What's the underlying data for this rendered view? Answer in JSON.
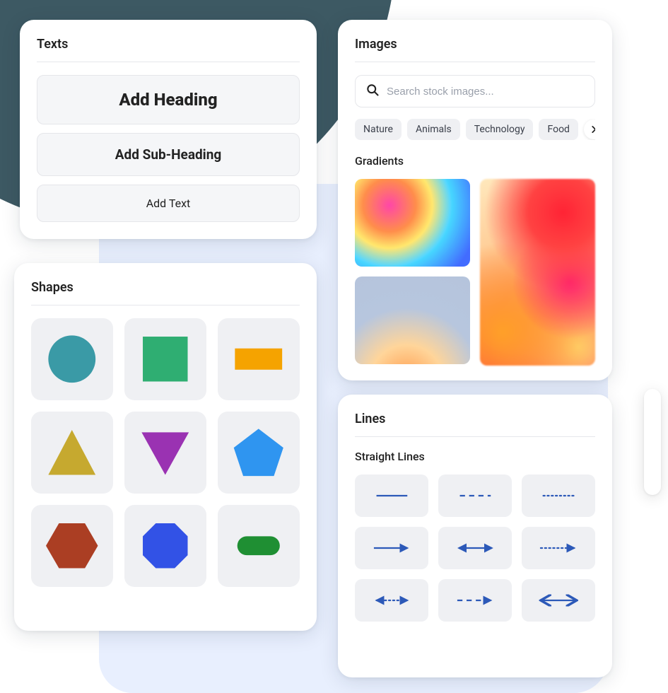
{
  "texts": {
    "title": "Texts",
    "heading": "Add Heading",
    "subheading": "Add Sub-Heading",
    "body": "Add Text"
  },
  "shapes": {
    "title": "Shapes",
    "items": [
      {
        "name": "circle",
        "fill": "#3a9aa6"
      },
      {
        "name": "square",
        "fill": "#2fae72"
      },
      {
        "name": "rectangle",
        "fill": "#f5a300"
      },
      {
        "name": "triangle-up",
        "fill": "#c6a92f"
      },
      {
        "name": "triangle-down",
        "fill": "#9a32b2"
      },
      {
        "name": "pentagon",
        "fill": "#2f95f0"
      },
      {
        "name": "hexagon",
        "fill": "#ab3e23"
      },
      {
        "name": "octagon",
        "fill": "#3252e6"
      },
      {
        "name": "capsule",
        "fill": "#1f8f33"
      }
    ]
  },
  "images": {
    "title": "Images",
    "search_placeholder": "Search stock images...",
    "chips": [
      "Nature",
      "Animals",
      "Technology",
      "Food"
    ],
    "gradients_title": "Gradients"
  },
  "lines": {
    "title": "Lines",
    "subtitle": "Straight Lines",
    "stroke": "#2c59b8",
    "items": [
      "solid",
      "dashed",
      "dotted",
      "arrow-right",
      "arrow-both",
      "dotted-arrow-right",
      "dotted-arrow-both",
      "dashed-arrow-right",
      "open-arrow-both"
    ]
  }
}
